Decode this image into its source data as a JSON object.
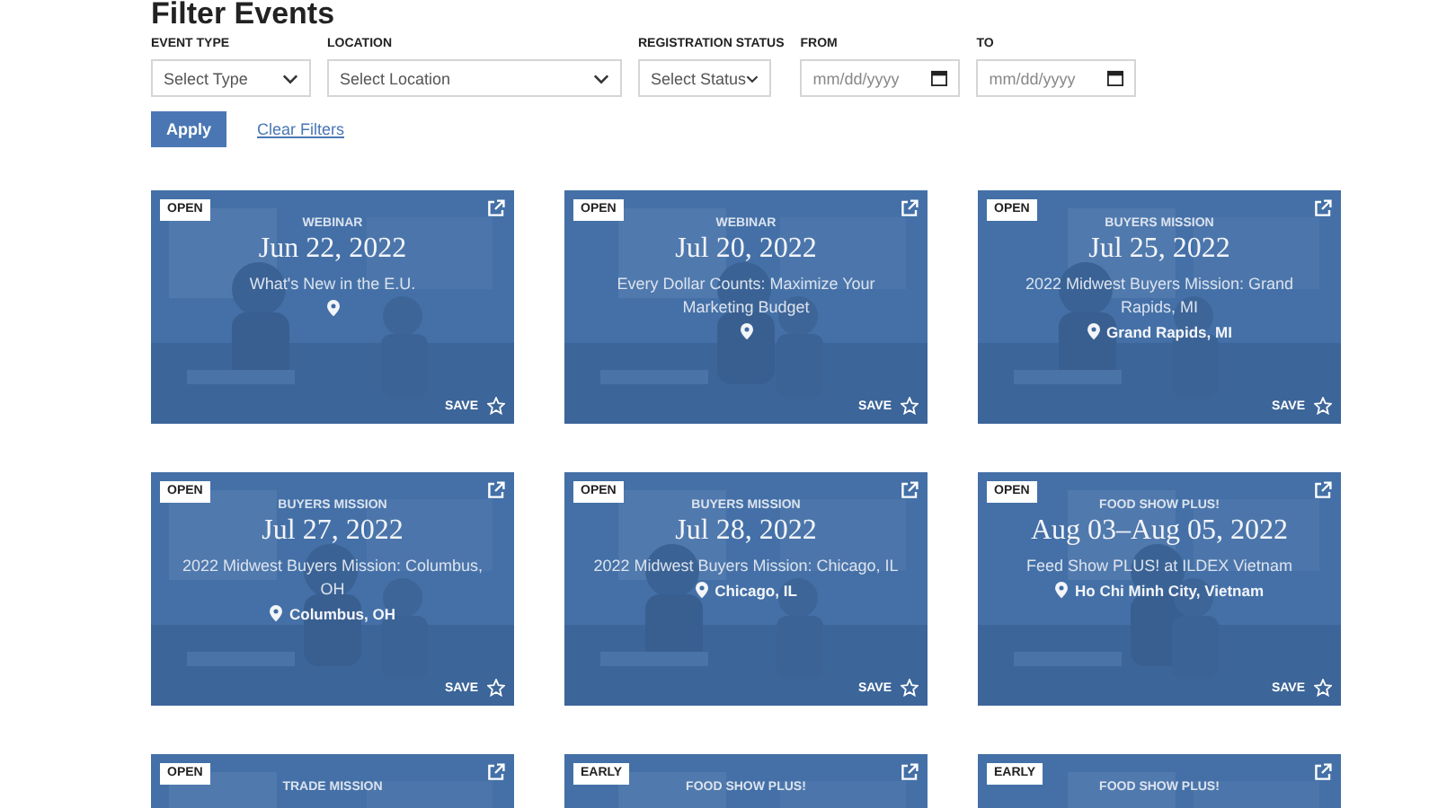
{
  "title": "Filter Events",
  "filters": [
    {
      "kind": "select",
      "label": "EVENT TYPE",
      "placeholder": "Select Type"
    },
    {
      "kind": "select",
      "label": "LOCATION",
      "placeholder": "Select Location"
    },
    {
      "kind": "select",
      "label": "REGISTRATION STATUS",
      "placeholder": "Select Status"
    },
    {
      "kind": "date",
      "label": "FROM",
      "placeholder": "mm/dd/yyyy"
    },
    {
      "kind": "date",
      "label": "TO",
      "placeholder": "mm/dd/yyyy"
    }
  ],
  "actions": {
    "apply": "Apply",
    "clear": "Clear Filters"
  },
  "events": [
    {
      "status": "OPEN",
      "category": "WEBINAR",
      "date": "Jun 22, 2022",
      "name": "What's New in the E.U.",
      "save": "SAVE",
      "saved": false
    },
    {
      "status": "OPEN",
      "category": "WEBINAR",
      "date": "Jul 20, 2022",
      "name": "Every Dollar Counts: Maximize Your Marketing Budget",
      "save": "SAVE",
      "saved": false
    },
    {
      "status": "OPEN",
      "category": "BUYERS MISSION",
      "date": "Jul 25, 2022",
      "name": "2022 Midwest Buyers Mission: Grand Rapids, MI",
      "location": "Grand Rapids, MI",
      "save": "SAVE",
      "saved": false
    },
    {
      "status": "OPEN",
      "category": "BUYERS MISSION",
      "date": "Jul 27, 2022",
      "name": "2022 Midwest Buyers Mission: Columbus, OH",
      "location": "Columbus, OH",
      "save": "SAVE",
      "saved": false
    },
    {
      "status": "OPEN",
      "category": "BUYERS MISSION",
      "date": "Jul 28, 2022",
      "name": "2022 Midwest Buyers Mission: Chicago, IL",
      "location": "Chicago, IL",
      "save": "SAVE",
      "saved": false
    },
    {
      "status": "OPEN",
      "category": "FOOD SHOW PLUS!",
      "date": "Aug 03–Aug 05, 2022",
      "name": "Feed Show PLUS! at ILDEX Vietnam",
      "location": "Ho Chi Minh City, Vietnam",
      "save": "SAVE",
      "saved": false
    },
    {
      "status": "OPEN",
      "category": "TRADE MISSION"
    },
    {
      "status": "EARLY",
      "category": "FOOD SHOW PLUS!"
    },
    {
      "status": "EARLY",
      "category": "FOOD SHOW PLUS!"
    }
  ]
}
